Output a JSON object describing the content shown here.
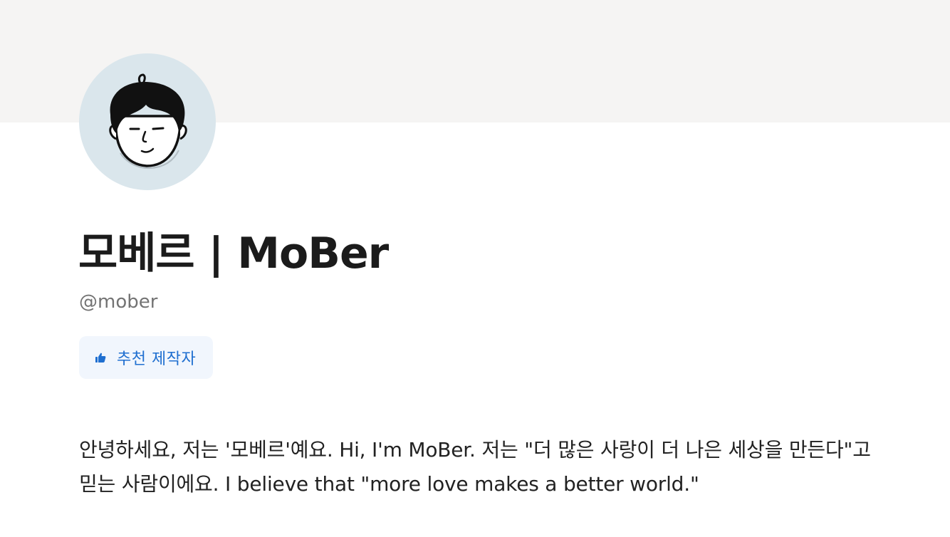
{
  "profile": {
    "name": "모베르 | MoBer",
    "handle": "@mober",
    "badge_label": "추천 제작자",
    "badge_icon": "thumbs-up-icon",
    "bio": "안녕하세요, 저는 '모베르'예요. Hi, I'm MoBer. 저는 \"더 많은 사랑이 더 나은 세상을 만든다\"고 믿는 사람이에요. I believe that \"more love makes a better world.\""
  },
  "colors": {
    "banner": "#f5f4f3",
    "avatar_bg": "#dae6ec",
    "badge_bg": "#f1f6fd",
    "badge_text": "#1f6fd0",
    "handle_text": "#737373"
  }
}
